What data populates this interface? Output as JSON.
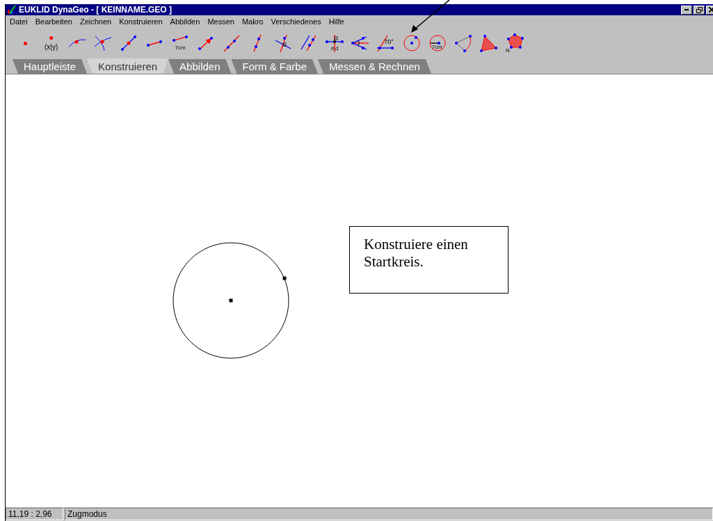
{
  "window": {
    "title": "EUKLID DynaGeo - [ KEINNAME.GEO ]"
  },
  "menu": [
    "Datei",
    "Bearbeiten",
    "Zeichnen",
    "Konstruieren",
    "Abbilden",
    "Messen",
    "Makro",
    "Verschiedenes",
    "Hilfe"
  ],
  "toolbar": [
    {
      "kind": "point"
    },
    {
      "kind": "coordinate-point",
      "label": "(x|y)"
    },
    {
      "kind": "point-on-curve"
    },
    {
      "kind": "intersection"
    },
    {
      "kind": "point-on-segment"
    },
    {
      "kind": "segment"
    },
    {
      "kind": "segment-length",
      "label": "7cm"
    },
    {
      "kind": "vector"
    },
    {
      "kind": "line"
    },
    {
      "kind": "ray"
    },
    {
      "kind": "perpendicular"
    },
    {
      "kind": "parallel"
    },
    {
      "kind": "bisector",
      "label": "d d"
    },
    {
      "kind": "angle-bisector"
    },
    {
      "kind": "angle",
      "label": "70°"
    },
    {
      "kind": "circle"
    },
    {
      "kind": "circle-radius",
      "label": "7cm"
    },
    {
      "kind": "arc"
    },
    {
      "kind": "triangle"
    },
    {
      "kind": "polygon",
      "label": "N"
    }
  ],
  "tabs": [
    {
      "label": "Hauptleiste",
      "selected": false
    },
    {
      "label": "Konstruieren",
      "selected": true
    },
    {
      "label": "Abbilden",
      "selected": false
    },
    {
      "label": "Form & Farbe",
      "selected": false
    },
    {
      "label": "Messen & Rechnen",
      "selected": false
    }
  ],
  "canvas": {
    "note": "Konstruiere einen Startkreis."
  },
  "status_bar": {
    "coordinates": "11,19 : 2,96",
    "mode": "Zugmodus"
  }
}
